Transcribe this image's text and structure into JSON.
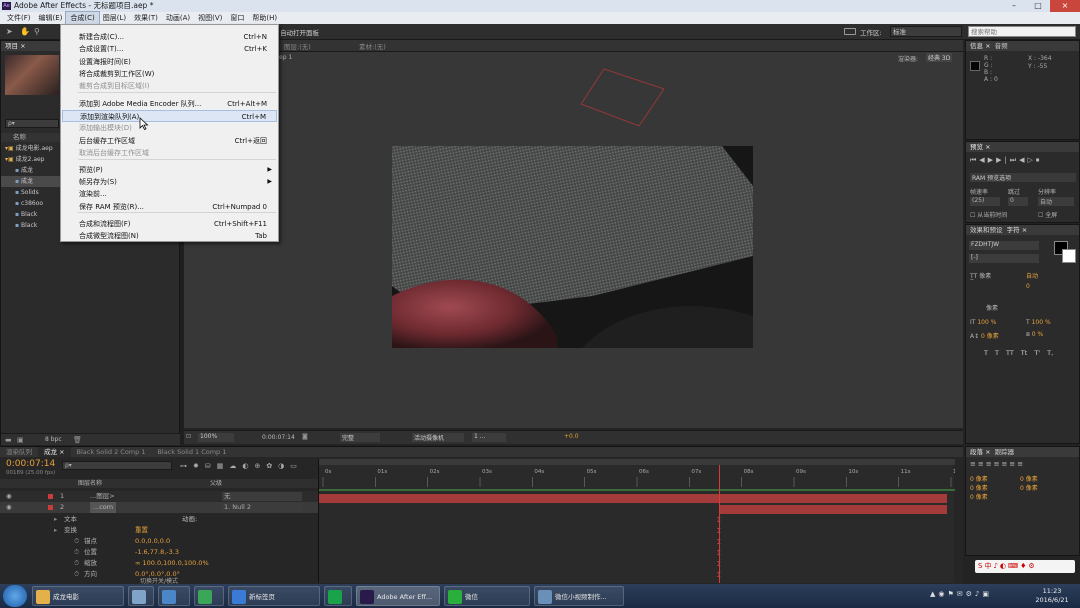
{
  "window": {
    "title": "Adobe After Effects - 无标题项目.aep *",
    "app_icon": "Ae"
  },
  "menubar": [
    "文件(F)",
    "编辑(E)",
    "合成(C)",
    "图层(L)",
    "效果(T)",
    "动画(A)",
    "视图(V)",
    "窗口",
    "帮助(H)"
  ],
  "toolbar": {
    "auto_open": "自动打开面板",
    "workspace_label": "工作区:",
    "workspace_value": "标准",
    "search_placeholder": "搜索帮助"
  },
  "composition_menu": {
    "items": [
      {
        "label": "新建合成(C)...",
        "shortcut": "Ctrl+N",
        "enabled": true
      },
      {
        "label": "合成设置(T)...",
        "shortcut": "Ctrl+K",
        "enabled": true
      },
      {
        "label": "设置海报时间(E)",
        "shortcut": "",
        "enabled": true
      },
      {
        "label": "将合成裁剪到工作区(W)",
        "shortcut": "",
        "enabled": true
      },
      {
        "label": "裁剪合成到目标区域(I)",
        "shortcut": "",
        "enabled": false
      },
      {
        "label": "添加到 Adobe Media Encoder 队列...",
        "shortcut": "Ctrl+Alt+M",
        "enabled": true
      },
      {
        "label": "添加到渲染队列(A)",
        "shortcut": "Ctrl+M",
        "enabled": true,
        "highlighted": true
      },
      {
        "label": "添加输出模块(D)",
        "shortcut": "",
        "enabled": false
      },
      {
        "label": "后台缓存工作区域",
        "shortcut": "Ctrl+返回",
        "enabled": true
      },
      {
        "label": "取消后台缓存工作区域",
        "shortcut": "",
        "enabled": false
      },
      {
        "label": "预览(P)",
        "shortcut": "",
        "enabled": true,
        "submenu": true
      },
      {
        "label": "帧另存为(S)",
        "shortcut": "",
        "enabled": true,
        "submenu": true
      },
      {
        "label": "渲染前...",
        "shortcut": "",
        "enabled": true
      },
      {
        "label": "保存 RAM 预览(R)...",
        "shortcut": "Ctrl+Numpad 0",
        "enabled": true
      },
      {
        "label": "合成和流程图(F)",
        "shortcut": "Ctrl+Shift+F11",
        "enabled": true
      },
      {
        "label": "合成微型流程图(N)",
        "shortcut": "Tab",
        "enabled": true
      }
    ]
  },
  "project_panel": {
    "tab": "项目 ×",
    "search_placeholder": "ρ▾",
    "column_name": "名称",
    "items": [
      "成龙电影.aep",
      "成龙2.aep",
      "成龙",
      "成龙",
      "Solids",
      "c386oo",
      "Black",
      "Black"
    ],
    "bpc": "8 bpc"
  },
  "comp_viewer": {
    "layer_tab": "图层:(无)",
    "footage_tab": "素材:(无)",
    "comp_tab": "ep 1",
    "renderer_label": "渲染器:",
    "renderer_value": "经典 3D",
    "zoom": "100%",
    "timecode": "0:00:07:14",
    "resolution": "完整",
    "camera": "活动摄像机",
    "views": "1 ...",
    "exposure": "+0.0"
  },
  "info_panel": {
    "tabs": [
      "信息 ×",
      "音频"
    ],
    "r": "R :",
    "g": "G :",
    "b": "B :",
    "a": "A : 0",
    "x": "X : -364",
    "y": "Y : -55"
  },
  "preview_panel": {
    "tab": "预览 ×",
    "ram_options": "RAM 预览选项",
    "frame_rate_label": "帧速率",
    "skip_label": "跳过",
    "resolution_label": "分辨率",
    "frame_rate": "(25)",
    "skip": "0",
    "resolution": "自动",
    "from_current": "从当前时间",
    "fullscreen": "全屏"
  },
  "effects_panel": {
    "tab": "效果和预设"
  },
  "character_panel": {
    "tab": "字符 ×",
    "font": "FZDHTJW",
    "size_unit": "像素",
    "auto": "自动",
    "tracking": "0",
    "scale_v": "100 %",
    "scale_h": "100 %",
    "baseline": "0 像素",
    "tsume": "0 %",
    "styles": [
      "T",
      "T",
      "TT",
      "Tt",
      "T'",
      "T,"
    ]
  },
  "paragraph_panel": {
    "tabs": [
      "段落 ×",
      "跟踪器"
    ],
    "indents": [
      "0 像素",
      "0 像素",
      "0 像素",
      "0 像素",
      "0 像素"
    ]
  },
  "timeline": {
    "tabs": [
      "渲染队列",
      "成龙 ×",
      "Black Solid 2 Comp 1",
      "Black Solid 1 Comp 1"
    ],
    "timecode": "0:00:07:14",
    "frame_info": "00189 (25.00 fps)",
    "column_name": "图层名称",
    "column_parent": "父级",
    "ticks": [
      "0s",
      "01s",
      "02s",
      "03s",
      "04s",
      "05s",
      "06s",
      "07s",
      "08s",
      "09s",
      "10s",
      "11s",
      "12s"
    ],
    "playhead_seconds": 7.56,
    "duration_seconds": 12,
    "layers": [
      {
        "num": "1",
        "name": "...图层>",
        "parent": "无"
      },
      {
        "num": "2",
        "name": "...com",
        "parent": "1. Null 2"
      }
    ],
    "props": [
      {
        "label": "文本",
        "value": "动画:"
      },
      {
        "label": "变换",
        "value": "重置"
      },
      {
        "label": "锚点",
        "value": "0.0,0.0,0.0"
      },
      {
        "label": "位置",
        "value": "-1.6,77.8,-3.3"
      },
      {
        "label": "缩放",
        "value": "∞ 100.0,100.0,100.0%"
      },
      {
        "label": "方向",
        "value": "0.0°,0.0°,0.0°"
      }
    ],
    "toggle_label": "切换开关/模式"
  },
  "taskbar": {
    "apps": [
      {
        "label": "成龙电影",
        "color": "#e3b04a"
      },
      {
        "label": "",
        "color": "#7fa4c8"
      },
      {
        "label": "",
        "color": "#4a86c8"
      },
      {
        "label": "",
        "color": "#3aa657"
      },
      {
        "label": "新标签页",
        "color": "#3a7bd5"
      },
      {
        "label": "",
        "color": "#1aa34a"
      },
      {
        "label": "Adobe After Eff...",
        "color": "#2a1a4a"
      },
      {
        "label": "微信",
        "color": "#2aae3c"
      },
      {
        "label": "微信小视频制作...",
        "color": "#6a8fb8"
      }
    ],
    "time": "11:23",
    "date": "2016/6/21"
  },
  "colors": {
    "accent_orange": "#e8a23c",
    "layer_bar": "#a33b3b",
    "menu_highlight": "#dce6f4"
  }
}
